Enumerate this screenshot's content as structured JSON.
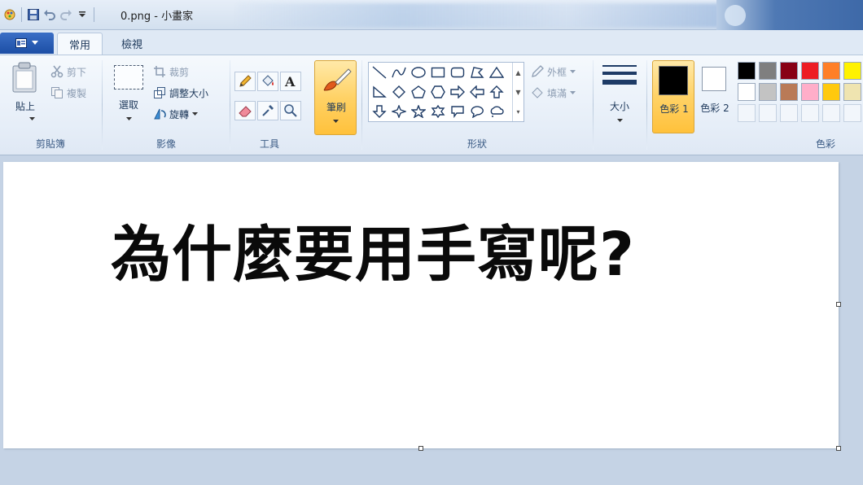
{
  "window": {
    "title": "0.png - 小畫家"
  },
  "tabs": [
    {
      "label": "常用"
    },
    {
      "label": "檢視"
    }
  ],
  "ribbon": {
    "clipboard": {
      "paste": "貼上",
      "cut": "剪下",
      "copy": "複製",
      "label": "剪貼簿"
    },
    "image": {
      "select": "選取",
      "crop": "裁剪",
      "resize": "調整大小",
      "rotate": "旋轉",
      "label": "影像"
    },
    "tools": {
      "label": "工具"
    },
    "brushes": {
      "label": "筆刷"
    },
    "shapes": {
      "outline": "外框",
      "fill": "填滿",
      "label": "形狀"
    },
    "size": {
      "label": "大小"
    },
    "colors": {
      "color1": "色彩 1",
      "color2": "色彩 2",
      "label": "色彩",
      "color1_value": "#000000",
      "color2_value": "#ffffff",
      "palette_row1": [
        "#000000",
        "#7f7f7f",
        "#880015",
        "#ed1c24",
        "#ff7f27",
        "#fff200"
      ],
      "palette_row2": [
        "#ffffff",
        "#c3c3c3",
        "#b97a57",
        "#ffaec9",
        "#ffc90e",
        "#efe4b0"
      ]
    }
  },
  "canvas": {
    "text": "為什麼要用手寫呢?"
  }
}
